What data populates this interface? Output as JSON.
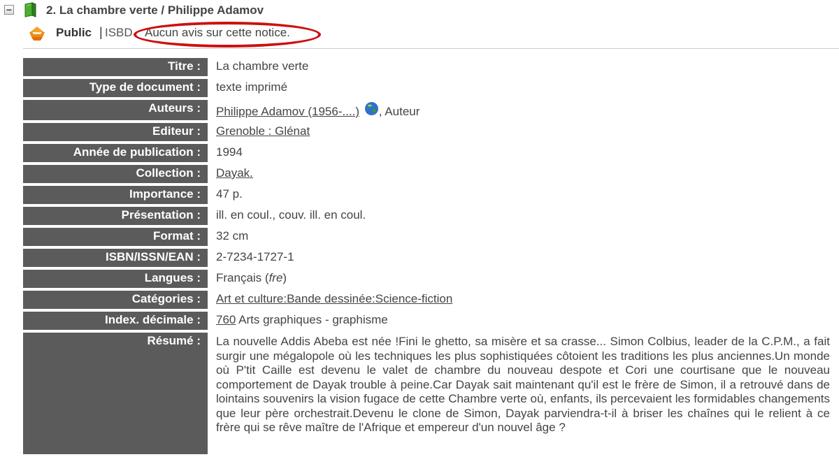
{
  "record": {
    "collapse_symbol": "−",
    "title": "2. La chambre verte / Philippe Adamov"
  },
  "tabs": {
    "public_label": "Public",
    "separator": "|",
    "isbd_label": "ISBD",
    "notice_text": "Aucun avis sur cette notice."
  },
  "fields": {
    "titre": {
      "label": "Titre :",
      "value": "La chambre verte"
    },
    "type_document": {
      "label": "Type de document :",
      "value": "texte imprimé"
    },
    "auteurs": {
      "label": "Auteurs :",
      "link": "Philippe Adamov (1956-....)",
      "suffix": ", Auteur"
    },
    "editeur": {
      "label": "Editeur :",
      "link": "Grenoble : Glénat"
    },
    "annee": {
      "label": "Année de publication :",
      "value": "1994"
    },
    "collection": {
      "label": "Collection :",
      "link": "Dayak."
    },
    "importance": {
      "label": "Importance :",
      "value": "47 p."
    },
    "presentation": {
      "label": "Présentation :",
      "value": "ill. en coul., couv. ill. en coul."
    },
    "format": {
      "label": "Format :",
      "value": "32 cm"
    },
    "isbn": {
      "label": "ISBN/ISSN/EAN :",
      "value": "2-7234-1727-1"
    },
    "langues": {
      "label": "Langues :",
      "value": "Français (",
      "code": "fre",
      "close": ")"
    },
    "categories": {
      "label": "Catégories :",
      "link": "Art et culture:Bande dessinée:Science-fiction"
    },
    "index": {
      "label": "Index. décimale :",
      "link": "760",
      "suffix": " Arts graphiques - graphisme"
    },
    "resume": {
      "label": "Résumé :",
      "value": "La nouvelle Addis Abeba est née !Fini le ghetto, sa misère et sa crasse... Simon Colbius, leader de la C.P.M., a fait surgir une mégalopole où les techniques les plus sophistiquées côtoient les traditions les plus anciennes.Un monde où P'tit Caille est devenu le valet de chambre du nouveau despote et Cori une courtisane que le nouveau comportement de Dayak trouble à peine.Car Dayak sait maintenant qu'il est le frère de Simon, il a retrouvé dans de lointains souvenirs la vision fugace de cette Chambre verte où, enfants, ils percevaient les formidables changements que leur père orchestrait.Devenu le clone de Simon, Dayak parviendra-t-il à briser les chaînes qui le relient à ce frère qui se rêve maître de l'Afrique et empereur d'un nouvel âge ?"
    }
  },
  "colors": {
    "label_background": "#5b5b5b",
    "highlight_ellipse": "#cc1111",
    "book_icon": "#3f9a2f"
  },
  "icons": {
    "collapse": "collapse-icon",
    "book": "book-icon",
    "basket": "basket-icon",
    "globe": "globe-icon"
  }
}
